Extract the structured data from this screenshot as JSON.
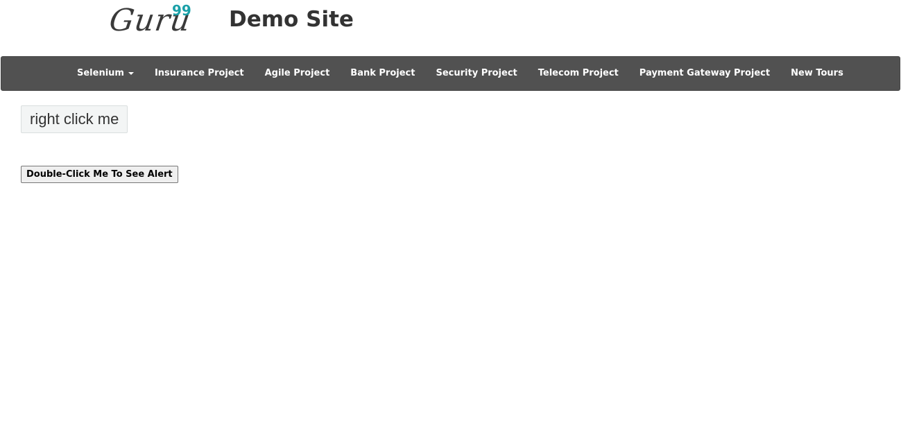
{
  "header": {
    "logo_word": "Guru",
    "logo_sup": "99",
    "site_title": "Demo Site"
  },
  "nav": {
    "items": [
      {
        "label": "Selenium",
        "has_dropdown": true
      },
      {
        "label": "Insurance Project"
      },
      {
        "label": "Agile Project"
      },
      {
        "label": "Bank Project"
      },
      {
        "label": "Security Project"
      },
      {
        "label": "Telecom Project"
      },
      {
        "label": "Payment Gateway Project"
      },
      {
        "label": "New Tours"
      }
    ]
  },
  "main": {
    "right_click_label": "right click me",
    "double_click_label": "Double-Click Me To See Alert"
  },
  "colors": {
    "navbar_bg": "#515151",
    "logo_accent": "#1aa0a8",
    "title_text": "#333333"
  }
}
